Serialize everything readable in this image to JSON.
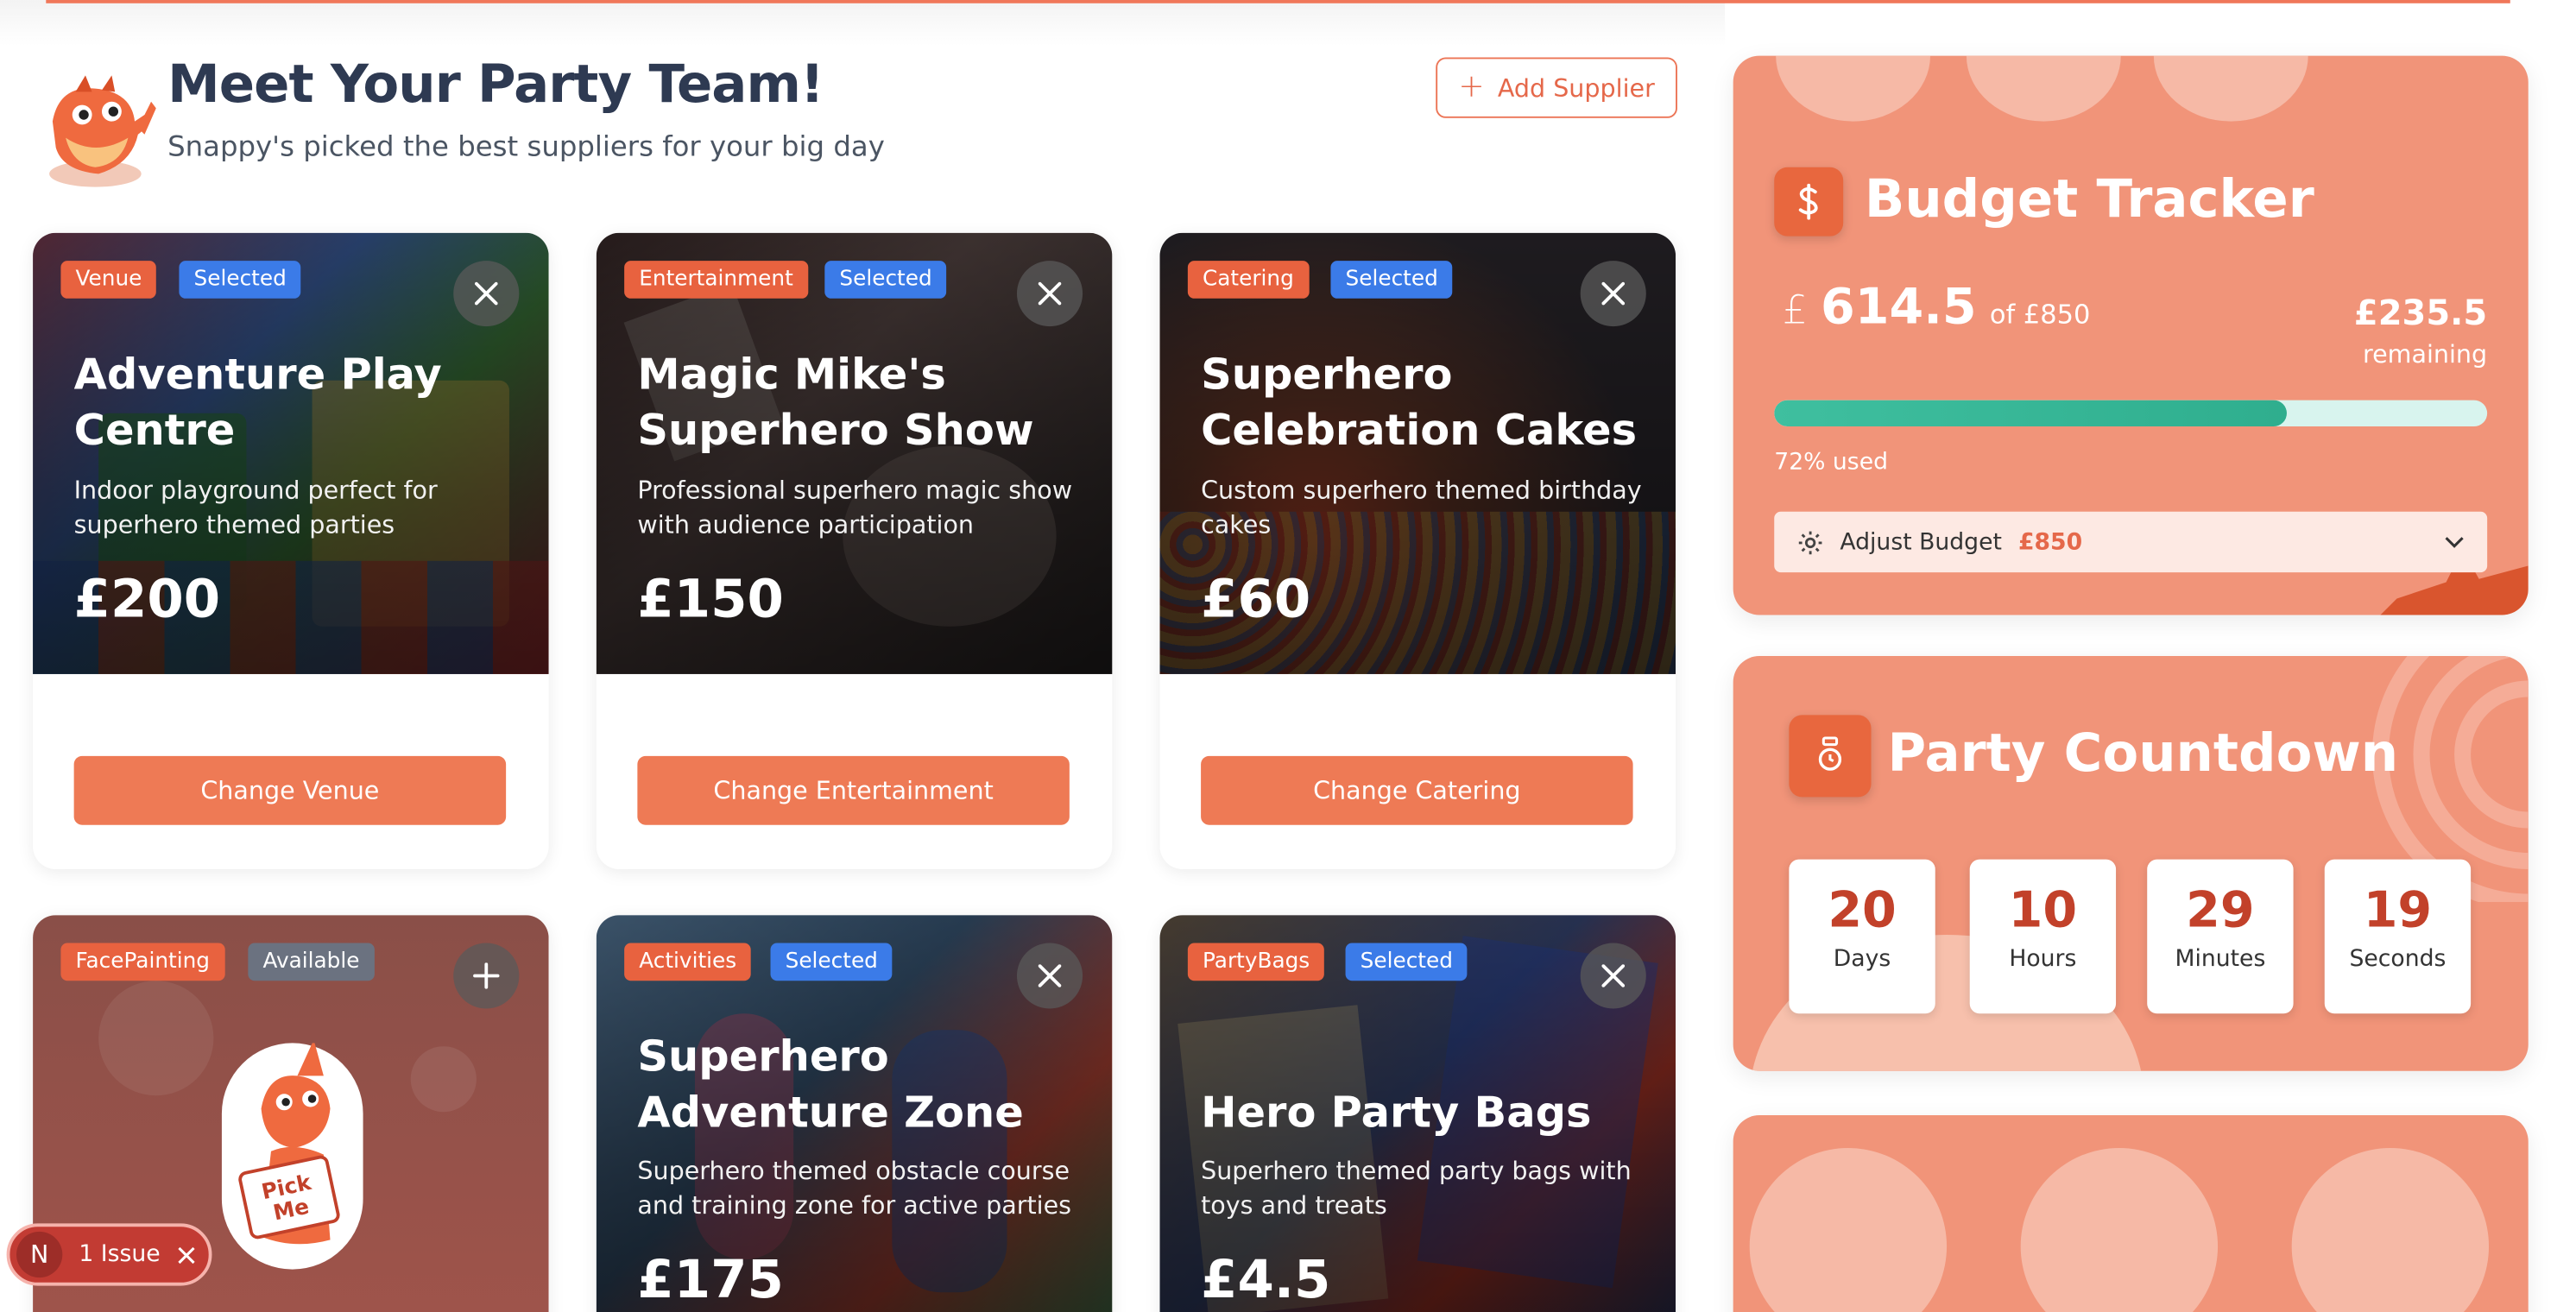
{
  "header": {
    "title": "Meet Your Party Team!",
    "subtitle": "Snappy's picked the best suppliers for your big day",
    "add_supplier_label": "Add Supplier"
  },
  "cards": [
    {
      "category": "Venue",
      "status": "Selected",
      "title": "Adventure Play Centre",
      "description": "Indoor playground perfect for superhero themed parties",
      "price": "£200",
      "button": "Change Venue"
    },
    {
      "category": "Entertainment",
      "status": "Selected",
      "title": "Magic Mike's Superhero Show",
      "description": "Professional superhero magic show with audience participation",
      "price": "£150",
      "button": "Change Entertainment"
    },
    {
      "category": "Catering",
      "status": "Selected",
      "title": "Superhero Celebration Cakes",
      "description": "Custom superhero themed birthday cakes",
      "price": "£60",
      "button": "Change Catering"
    },
    {
      "category": "FacePainting",
      "status": "Available",
      "pick_me": "Pick Me"
    },
    {
      "category": "Activities",
      "status": "Selected",
      "title": "Superhero Adventure Zone",
      "description": "Superhero themed obstacle course and training zone for active parties",
      "price": "£175"
    },
    {
      "category": "PartyBags",
      "status": "Selected",
      "title": "Hero Party Bags",
      "description": "Superhero themed party bags with toys and treats",
      "price": "£4.5"
    }
  ],
  "budget": {
    "title": "Budget Tracker",
    "currency": "£",
    "spent": "614.5",
    "of_total": "of £850",
    "remaining_amount": "£235.5",
    "remaining_label": "remaining",
    "used_fraction": 0.72,
    "used_label": "72% used",
    "adjust_label": "Adjust Budget",
    "adjust_value": "£850"
  },
  "countdown": {
    "title": "Party Countdown",
    "units": [
      {
        "value": "20",
        "label": "Days"
      },
      {
        "value": "10",
        "label": "Hours"
      },
      {
        "value": "29",
        "label": "Minutes"
      },
      {
        "value": "19",
        "label": "Seconds"
      }
    ]
  },
  "issue": {
    "avatar_letter": "N",
    "label": "1 Issue"
  },
  "colors": {
    "accent": "#ee7a55",
    "panel": "#f19479",
    "selected_badge": "#3b7be8",
    "progress": "#3fbf9f",
    "title_text": "#2e3a52"
  }
}
